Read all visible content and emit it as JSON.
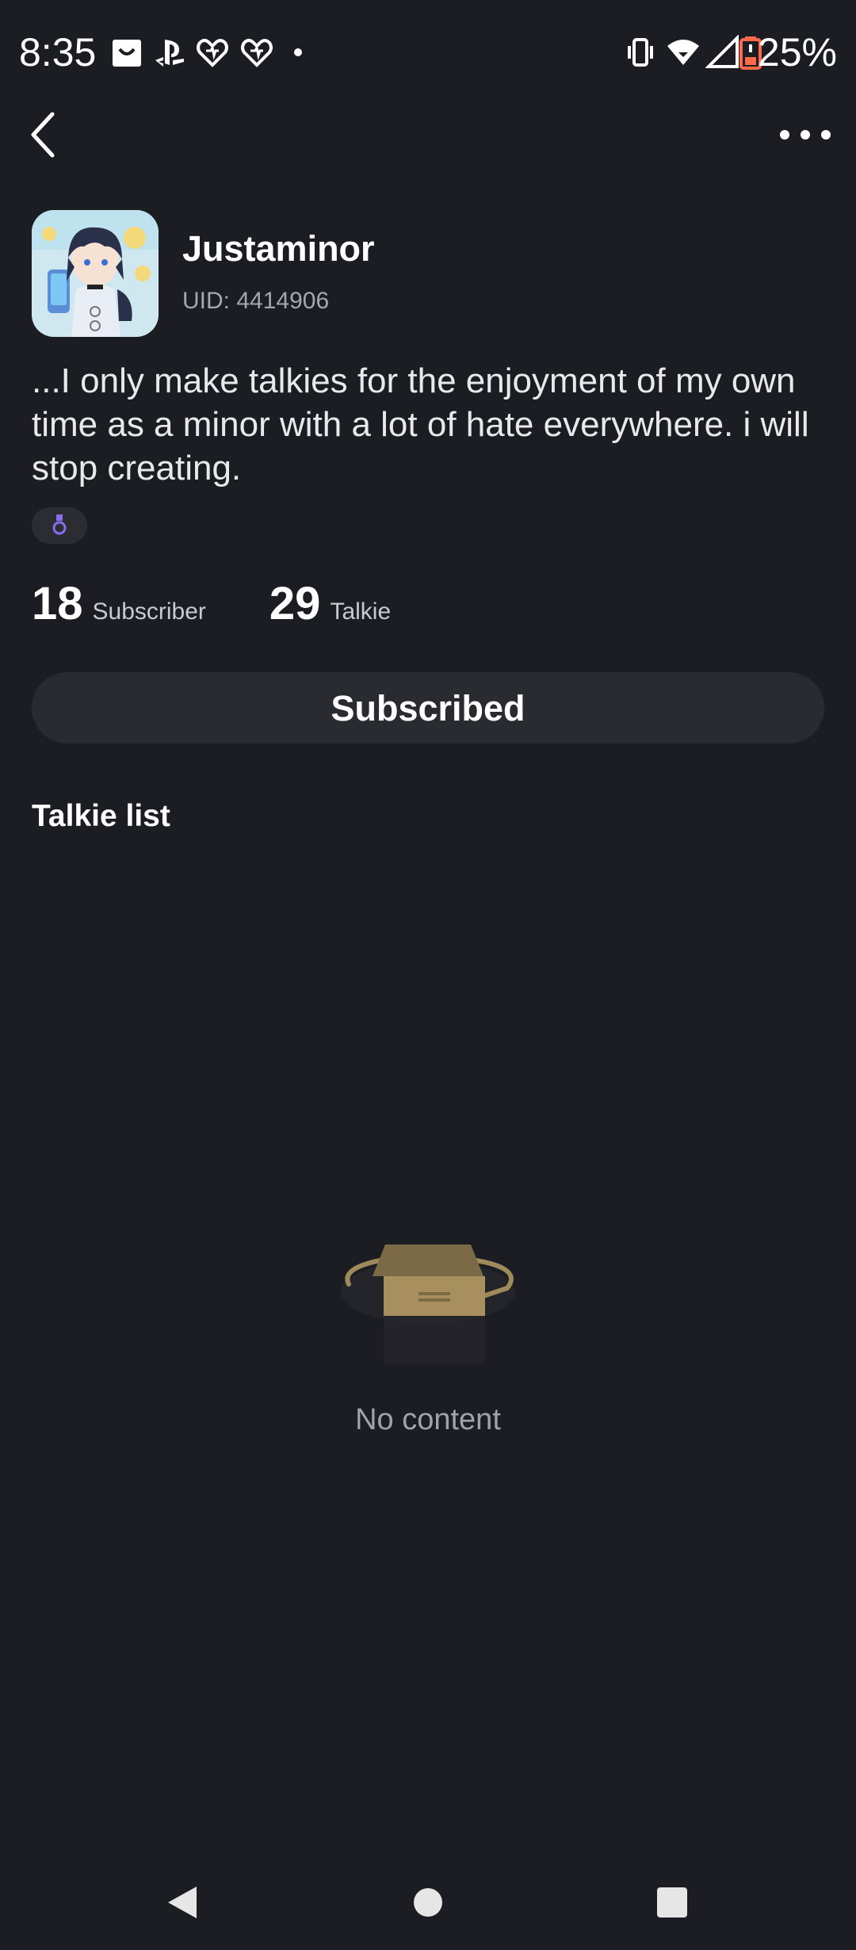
{
  "status_bar": {
    "time": "8:35",
    "battery": "25%",
    "icons": [
      "shopping-bag-icon",
      "playstation-icon",
      "heart-app-icon",
      "heart-app-icon",
      "dot-icon",
      "vibrate-icon",
      "wifi-icon",
      "signal-icon",
      "battery-icon"
    ]
  },
  "header": {
    "back_icon": "chevron-left-icon",
    "more_icon": "more-horizontal-icon"
  },
  "profile": {
    "name": "Justaminor",
    "uid": "UID: 4414906",
    "bio": "...I only make talkies for the enjoyment of my own time as a minor with a lot of hate everywhere. i will stop creating.",
    "badge_icon": "medal-icon",
    "subscribers_count": "18",
    "subscribers_label": "Subscriber",
    "talkies_count": "29",
    "talkies_label": "Talkie",
    "subscribe_label": "Subscribed"
  },
  "talkie_list": {
    "title": "Talkie list",
    "empty_text": "No content",
    "empty_icon": "empty-box-icon"
  },
  "nav_bar": {
    "icons": [
      "back-triangle-icon",
      "home-circle-icon",
      "recents-square-icon"
    ]
  },
  "colors": {
    "background": "#1c1d22",
    "button": "#2a2b31",
    "muted_text": "#a6a7ad",
    "accent_purple": "#8a6cf0"
  }
}
